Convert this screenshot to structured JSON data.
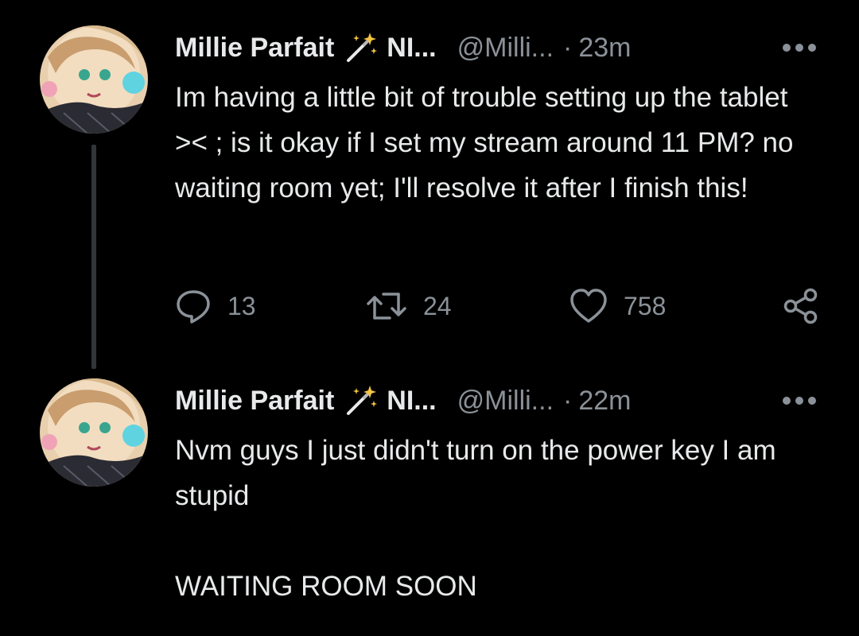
{
  "tweets": [
    {
      "display_name": "Millie Parfait",
      "name_truncated": "NI...",
      "handle": "@Milli...",
      "separator": "·",
      "time": "23m",
      "text": "Im having a little bit of trouble setting up the tablet >< ; is it okay if I set my stream around 11 PM? no waiting room yet; I'll resolve it after I finish this!",
      "reply_count": "13",
      "retweet_count": "24",
      "like_count": "758"
    },
    {
      "display_name": "Millie Parfait",
      "name_truncated": "NI...",
      "handle": "@Milli...",
      "separator": "·",
      "time": "22m",
      "text": "Nvm guys I just didn't turn on the power key I am stupid\n\nWAITING ROOM SOON"
    }
  ],
  "icons": {
    "name_emoji": "magic-wand-icon",
    "more": "more-options-icon",
    "reply": "reply-icon",
    "retweet": "retweet-icon",
    "like": "like-icon",
    "share": "share-icon"
  },
  "colors": {
    "background": "#000000",
    "primary_text": "#e7e9ea",
    "secondary_text": "#8b9198",
    "thread_line": "#333639"
  }
}
